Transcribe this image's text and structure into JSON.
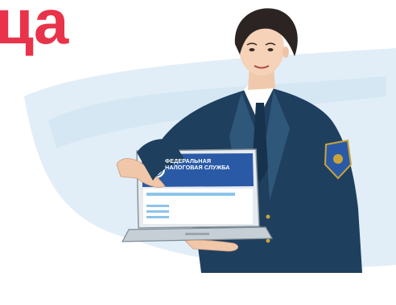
{
  "headline": {
    "fragment": "ца"
  },
  "laptop": {
    "service_line_1": "ФЕДЕРАЛЬНАЯ",
    "service_line_2": "НАЛОГОВАЯ СЛУЖБА"
  },
  "colors": {
    "accent": "#e8334a",
    "uniform": "#1f3f5e",
    "uniform_light": "#2e5779",
    "screen_header": "#2a5aa6",
    "screen_bar": "#8cc3ea",
    "wash": "#dcebf6"
  }
}
